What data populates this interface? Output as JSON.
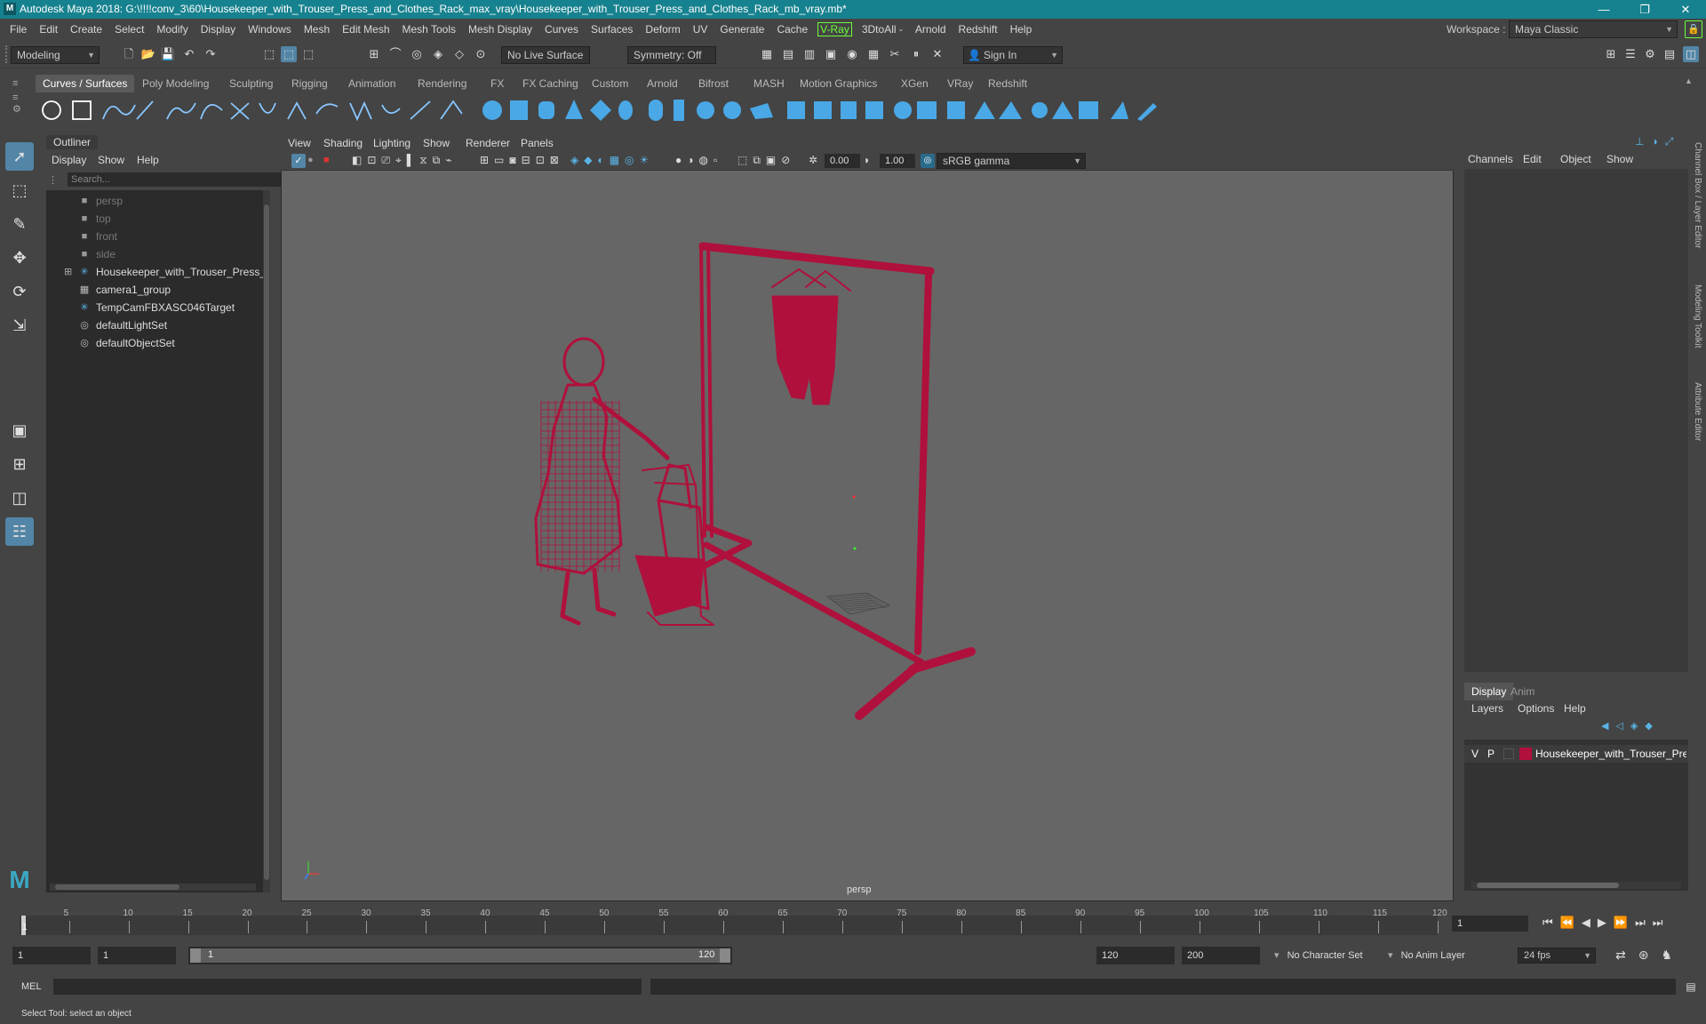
{
  "titlebar": {
    "title": "Autodesk Maya 2018: G:\\!!!!conv_3\\60\\Housekeeper_with_Trouser_Press_and_Clothes_Rack_max_vray\\Housekeeper_with_Trouser_Press_and_Clothes_Rack_mb_vray.mb*",
    "minimize": "—",
    "maximize": "❐",
    "close": "✕"
  },
  "menubar": {
    "items": [
      "File",
      "Edit",
      "Create",
      "Select",
      "Modify",
      "Display",
      "Windows",
      "Mesh",
      "Edit Mesh",
      "Mesh Tools",
      "Mesh Display",
      "Curves",
      "Surfaces",
      "Deform",
      "UV",
      "Generate",
      "Cache"
    ],
    "vray": "V-Ray",
    "items2": [
      "3DtoAll -",
      "Arnold",
      "Redshift",
      "Help"
    ],
    "workspace_label": "Workspace :",
    "workspace_value": "Maya Classic"
  },
  "statusline": {
    "mode": "Modeling",
    "live_surface": "No Live Surface",
    "symmetry": "Symmetry: Off",
    "sign_in": "Sign In"
  },
  "shelf": {
    "tabs": [
      "Curves / Surfaces",
      "Poly Modeling",
      "Sculpting",
      "Rigging",
      "Animation",
      "Rendering",
      "FX",
      "FX Caching",
      "Custom",
      "Arnold",
      "Bifrost",
      "MASH",
      "Motion Graphics",
      "XGen",
      "VRay",
      "Redshift"
    ],
    "active_tab": "Curves / Surfaces"
  },
  "outliner": {
    "title": "Outliner",
    "menus": [
      "Display",
      "Show",
      "Help"
    ],
    "search_placeholder": "Search...",
    "items": [
      {
        "label": "persp",
        "icon": "camera-icon",
        "dim": true
      },
      {
        "label": "top",
        "icon": "camera-icon",
        "dim": true
      },
      {
        "label": "front",
        "icon": "camera-icon",
        "dim": true
      },
      {
        "label": "side",
        "icon": "camera-icon",
        "dim": true
      },
      {
        "label": "Housekeeper_with_Trouser_Press_and_Clothes_Rack",
        "icon": "transform-icon",
        "dim": false,
        "expandable": true
      },
      {
        "label": "camera1_group",
        "icon": "group-icon",
        "dim": false
      },
      {
        "label": "TempCamFBXASC046Target",
        "icon": "transform-icon",
        "dim": false
      },
      {
        "label": "defaultLightSet",
        "icon": "set-icon",
        "dim": false
      },
      {
        "label": "defaultObjectSet",
        "icon": "set-icon",
        "dim": false
      }
    ]
  },
  "viewport": {
    "menus": [
      "View",
      "Shading",
      "Lighting",
      "Show",
      "Renderer",
      "Panels"
    ],
    "near_value": "0.00",
    "far_value": "1.00",
    "color_space": "sRGB gamma",
    "camera_label": "persp",
    "wire_color": "#b0103c"
  },
  "channelbox": {
    "menus": [
      "Channels",
      "Edit",
      "Object",
      "Show"
    ],
    "side_tabs": [
      "Channel Box / Layer Editor",
      "Modeling Toolkit",
      "Attribute Editor"
    ]
  },
  "layereditor": {
    "tabs": [
      "Display",
      "Anim"
    ],
    "active_tab": "Display",
    "menus": [
      "Layers",
      "Options",
      "Help"
    ],
    "layer": {
      "v": "V",
      "p": "P",
      "name": "Housekeeper_with_Trouser_Press",
      "color": "#b0103c"
    }
  },
  "timeslider": {
    "ticks": [
      "5",
      "10",
      "15",
      "20",
      "25",
      "30",
      "35",
      "40",
      "45",
      "50",
      "55",
      "60",
      "65",
      "70",
      "75",
      "80",
      "85",
      "90",
      "95",
      "100",
      "105",
      "110",
      "115",
      "120"
    ],
    "current_frame": "1",
    "current_frame_field": "1"
  },
  "rangeslider": {
    "start": "1",
    "playback_start": "1",
    "range_start_label": "1",
    "range_end_label": "120",
    "playback_end": "120",
    "end": "200",
    "character_set": "No Character Set",
    "anim_layer": "No Anim Layer",
    "fps": "24 fps"
  },
  "cmdline": {
    "label": "MEL"
  },
  "helpline": {
    "text": "Select Tool: select an object"
  }
}
